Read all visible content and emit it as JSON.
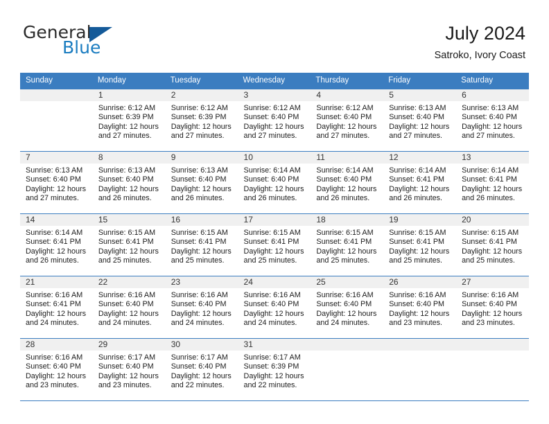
{
  "logo": {
    "word_one": "General",
    "word_two": "Blue",
    "triangle_icon": "blue-triangle-icon",
    "color_dark": "#2b2b2b",
    "color_blue": "#1a7cc0",
    "triangle_color": "#145a99"
  },
  "header": {
    "title": "July 2024",
    "subtitle": "Satroko, Ivory Coast"
  },
  "theme": {
    "header_bg": "#3b7dc0",
    "header_text": "#ffffff",
    "daynum_bg": "#f0f0f0",
    "grid_line": "#3b7dc0"
  },
  "weekdays": [
    "Sunday",
    "Monday",
    "Tuesday",
    "Wednesday",
    "Thursday",
    "Friday",
    "Saturday"
  ],
  "weeks": [
    [
      {
        "day": "",
        "lines": []
      },
      {
        "day": "1",
        "lines": [
          "Sunrise: 6:12 AM",
          "Sunset: 6:39 PM",
          "Daylight: 12 hours",
          "and 27 minutes."
        ]
      },
      {
        "day": "2",
        "lines": [
          "Sunrise: 6:12 AM",
          "Sunset: 6:39 PM",
          "Daylight: 12 hours",
          "and 27 minutes."
        ]
      },
      {
        "day": "3",
        "lines": [
          "Sunrise: 6:12 AM",
          "Sunset: 6:40 PM",
          "Daylight: 12 hours",
          "and 27 minutes."
        ]
      },
      {
        "day": "4",
        "lines": [
          "Sunrise: 6:12 AM",
          "Sunset: 6:40 PM",
          "Daylight: 12 hours",
          "and 27 minutes."
        ]
      },
      {
        "day": "5",
        "lines": [
          "Sunrise: 6:13 AM",
          "Sunset: 6:40 PM",
          "Daylight: 12 hours",
          "and 27 minutes."
        ]
      },
      {
        "day": "6",
        "lines": [
          "Sunrise: 6:13 AM",
          "Sunset: 6:40 PM",
          "Daylight: 12 hours",
          "and 27 minutes."
        ]
      }
    ],
    [
      {
        "day": "7",
        "lines": [
          "Sunrise: 6:13 AM",
          "Sunset: 6:40 PM",
          "Daylight: 12 hours",
          "and 27 minutes."
        ]
      },
      {
        "day": "8",
        "lines": [
          "Sunrise: 6:13 AM",
          "Sunset: 6:40 PM",
          "Daylight: 12 hours",
          "and 26 minutes."
        ]
      },
      {
        "day": "9",
        "lines": [
          "Sunrise: 6:13 AM",
          "Sunset: 6:40 PM",
          "Daylight: 12 hours",
          "and 26 minutes."
        ]
      },
      {
        "day": "10",
        "lines": [
          "Sunrise: 6:14 AM",
          "Sunset: 6:40 PM",
          "Daylight: 12 hours",
          "and 26 minutes."
        ]
      },
      {
        "day": "11",
        "lines": [
          "Sunrise: 6:14 AM",
          "Sunset: 6:40 PM",
          "Daylight: 12 hours",
          "and 26 minutes."
        ]
      },
      {
        "day": "12",
        "lines": [
          "Sunrise: 6:14 AM",
          "Sunset: 6:41 PM",
          "Daylight: 12 hours",
          "and 26 minutes."
        ]
      },
      {
        "day": "13",
        "lines": [
          "Sunrise: 6:14 AM",
          "Sunset: 6:41 PM",
          "Daylight: 12 hours",
          "and 26 minutes."
        ]
      }
    ],
    [
      {
        "day": "14",
        "lines": [
          "Sunrise: 6:14 AM",
          "Sunset: 6:41 PM",
          "Daylight: 12 hours",
          "and 26 minutes."
        ]
      },
      {
        "day": "15",
        "lines": [
          "Sunrise: 6:15 AM",
          "Sunset: 6:41 PM",
          "Daylight: 12 hours",
          "and 25 minutes."
        ]
      },
      {
        "day": "16",
        "lines": [
          "Sunrise: 6:15 AM",
          "Sunset: 6:41 PM",
          "Daylight: 12 hours",
          "and 25 minutes."
        ]
      },
      {
        "day": "17",
        "lines": [
          "Sunrise: 6:15 AM",
          "Sunset: 6:41 PM",
          "Daylight: 12 hours",
          "and 25 minutes."
        ]
      },
      {
        "day": "18",
        "lines": [
          "Sunrise: 6:15 AM",
          "Sunset: 6:41 PM",
          "Daylight: 12 hours",
          "and 25 minutes."
        ]
      },
      {
        "day": "19",
        "lines": [
          "Sunrise: 6:15 AM",
          "Sunset: 6:41 PM",
          "Daylight: 12 hours",
          "and 25 minutes."
        ]
      },
      {
        "day": "20",
        "lines": [
          "Sunrise: 6:15 AM",
          "Sunset: 6:41 PM",
          "Daylight: 12 hours",
          "and 25 minutes."
        ]
      }
    ],
    [
      {
        "day": "21",
        "lines": [
          "Sunrise: 6:16 AM",
          "Sunset: 6:41 PM",
          "Daylight: 12 hours",
          "and 24 minutes."
        ]
      },
      {
        "day": "22",
        "lines": [
          "Sunrise: 6:16 AM",
          "Sunset: 6:40 PM",
          "Daylight: 12 hours",
          "and 24 minutes."
        ]
      },
      {
        "day": "23",
        "lines": [
          "Sunrise: 6:16 AM",
          "Sunset: 6:40 PM",
          "Daylight: 12 hours",
          "and 24 minutes."
        ]
      },
      {
        "day": "24",
        "lines": [
          "Sunrise: 6:16 AM",
          "Sunset: 6:40 PM",
          "Daylight: 12 hours",
          "and 24 minutes."
        ]
      },
      {
        "day": "25",
        "lines": [
          "Sunrise: 6:16 AM",
          "Sunset: 6:40 PM",
          "Daylight: 12 hours",
          "and 24 minutes."
        ]
      },
      {
        "day": "26",
        "lines": [
          "Sunrise: 6:16 AM",
          "Sunset: 6:40 PM",
          "Daylight: 12 hours",
          "and 23 minutes."
        ]
      },
      {
        "day": "27",
        "lines": [
          "Sunrise: 6:16 AM",
          "Sunset: 6:40 PM",
          "Daylight: 12 hours",
          "and 23 minutes."
        ]
      }
    ],
    [
      {
        "day": "28",
        "lines": [
          "Sunrise: 6:16 AM",
          "Sunset: 6:40 PM",
          "Daylight: 12 hours",
          "and 23 minutes."
        ]
      },
      {
        "day": "29",
        "lines": [
          "Sunrise: 6:17 AM",
          "Sunset: 6:40 PM",
          "Daylight: 12 hours",
          "and 23 minutes."
        ]
      },
      {
        "day": "30",
        "lines": [
          "Sunrise: 6:17 AM",
          "Sunset: 6:40 PM",
          "Daylight: 12 hours",
          "and 22 minutes."
        ]
      },
      {
        "day": "31",
        "lines": [
          "Sunrise: 6:17 AM",
          "Sunset: 6:39 PM",
          "Daylight: 12 hours",
          "and 22 minutes."
        ]
      },
      {
        "day": "",
        "lines": []
      },
      {
        "day": "",
        "lines": []
      },
      {
        "day": "",
        "lines": []
      }
    ]
  ]
}
